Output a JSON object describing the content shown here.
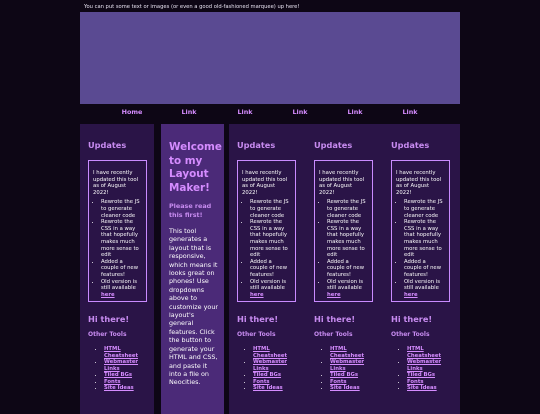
{
  "topbar": {
    "text": "You can put some text or images (or even a good old-fashioned marquee) up here!"
  },
  "nav": {
    "items": [
      "Home",
      "Link",
      "Link",
      "Link",
      "Link",
      "Link"
    ]
  },
  "colors": {
    "background": "#0d0615",
    "banner": "#5a4a92",
    "panel": "#2a1447",
    "main_panel": "#4b2a78",
    "accent": "#d58cff",
    "heading": "#c78bf0"
  },
  "updates": {
    "heading": "Updates",
    "intro": "I have recently updated this tool as of August 2022!",
    "items": [
      "Rewrote the JS to generate cleaner code",
      "Rewrote the CSS in a way that hopefully makes much more sense to edit",
      "Added a couple of new features!",
      "Old version is still available "
    ],
    "here_link": "here"
  },
  "hi": {
    "heading": "Hi there!",
    "other_tools": "Other Tools"
  },
  "tools": [
    "HTML Cheatsheet",
    "Webmaster Links",
    "Tiled BGs",
    "Fonts",
    "Site Ideas"
  ],
  "main": {
    "welcome": "Welcome to my Layout Maker!",
    "read": "Please read this first!",
    "text": "This tool generates a layout that is responsive, which means it looks great on phones! Use dropdowns above to customize your layout's general features. Click the button to generate your HTML and CSS, and paste it into a file on Neocities."
  }
}
